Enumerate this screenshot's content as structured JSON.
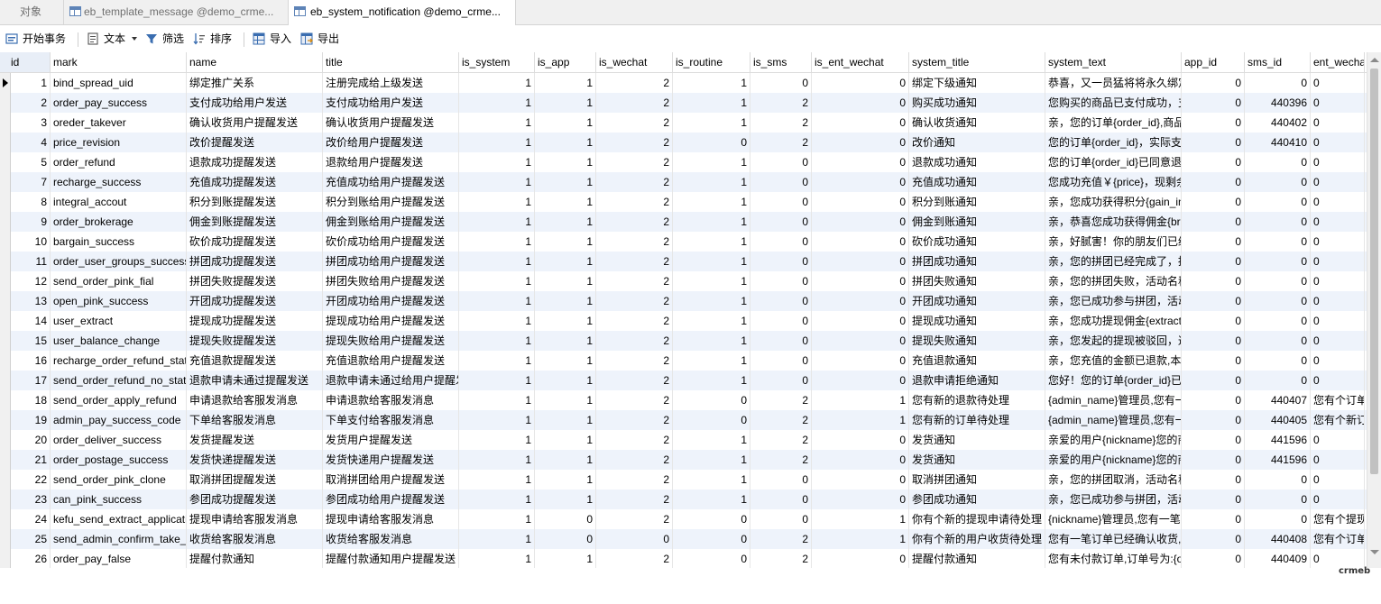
{
  "tabs": [
    {
      "label": "对象",
      "active": false
    },
    {
      "label": "eb_template_message @demo_crme...",
      "active": false
    },
    {
      "label": "eb_system_notification @demo_crme...",
      "active": true
    }
  ],
  "toolbar": {
    "begin_transaction": "开始事务",
    "text": "文本",
    "filter": "筛选",
    "sort": "排序",
    "import": "导入",
    "export": "导出"
  },
  "table": {
    "columns": [
      {
        "label": "id",
        "align": "n"
      },
      {
        "label": "mark",
        "align": "t"
      },
      {
        "label": "name",
        "align": "t"
      },
      {
        "label": "title",
        "align": "t"
      },
      {
        "label": "is_system",
        "align": "n"
      },
      {
        "label": "is_app",
        "align": "n"
      },
      {
        "label": "is_wechat",
        "align": "n"
      },
      {
        "label": "is_routine",
        "align": "n"
      },
      {
        "label": "is_sms",
        "align": "n"
      },
      {
        "label": "is_ent_wechat",
        "align": "n"
      },
      {
        "label": "system_title",
        "align": "t"
      },
      {
        "label": "system_text",
        "align": "t"
      },
      {
        "label": "app_id",
        "align": "n"
      },
      {
        "label": "sms_id",
        "align": "n"
      },
      {
        "label": "ent_wechat",
        "align": "t"
      }
    ],
    "rows": [
      [
        "1",
        "bind_spread_uid",
        "绑定推广关系",
        "注册完成给上级发送",
        "1",
        "1",
        "2",
        "1",
        "0",
        "0",
        "绑定下级通知",
        "恭喜，又一员猛将将永久绑定到您的团队",
        "0",
        "0",
        "0"
      ],
      [
        "2",
        "order_pay_success",
        "支付成功给用户发送",
        "支付成功给用户发送",
        "1",
        "1",
        "2",
        "1",
        "2",
        "0",
        "购买成功通知",
        "您购买的商品已支付成功，支付金额",
        "0",
        "440396",
        "0"
      ],
      [
        "3",
        "oreder_takever",
        "确认收货用户提醒发送",
        "确认收货用户提醒发送",
        "1",
        "1",
        "2",
        "1",
        "2",
        "0",
        "确认收货通知",
        "亲，您的订单{order_id},商品已确认收货",
        "0",
        "440402",
        "0"
      ],
      [
        "4",
        "price_revision",
        "改价提醒发送",
        "改价给用户提醒发送",
        "1",
        "1",
        "2",
        "0",
        "2",
        "0",
        "改价通知",
        "您的订单{order_id}，实际支付金额已被修改",
        "0",
        "440410",
        "0"
      ],
      [
        "5",
        "order_refund",
        "退款成功提醒发送",
        "退款给用户提醒发送",
        "1",
        "1",
        "2",
        "1",
        "0",
        "0",
        "退款成功通知",
        "您的订单{order_id}已同意退款",
        "0",
        "0",
        "0"
      ],
      [
        "7",
        "recharge_success",
        "充值成功提醒发送",
        "充值成功给用户提醒发送",
        "1",
        "1",
        "2",
        "1",
        "0",
        "0",
        "充值成功通知",
        "您成功充值￥{price}，现剩余余额",
        "0",
        "0",
        "0"
      ],
      [
        "8",
        "integral_accout",
        "积分到账提醒发送",
        "积分到账给用户提醒发送",
        "1",
        "1",
        "2",
        "1",
        "0",
        "0",
        "积分到账通知",
        "亲，您成功获得积分{gain_integral}",
        "0",
        "0",
        "0"
      ],
      [
        "9",
        "order_brokerage",
        "佣金到账提醒发送",
        "佣金到账给用户提醒发送",
        "1",
        "1",
        "2",
        "1",
        "0",
        "0",
        "佣金到账通知",
        "亲，恭喜您成功获得佣金{brokerage_price}",
        "0",
        "0",
        "0"
      ],
      [
        "10",
        "bargain_success",
        "砍价成功提醒发送",
        "砍价成功给用户提醒发送",
        "1",
        "1",
        "2",
        "1",
        "0",
        "0",
        "砍价成功通知",
        "亲，好腻害！你的朋友们已经帮你砍到底价",
        "0",
        "0",
        "0"
      ],
      [
        "11",
        "order_user_groups_success",
        "拼团成功提醒发送",
        "拼团成功给用户提醒发送",
        "1",
        "1",
        "2",
        "1",
        "0",
        "0",
        "拼团成功通知",
        "亲，您的拼团已经完成了，拼团名称",
        "0",
        "0",
        "0"
      ],
      [
        "12",
        "send_order_pink_fial",
        "拼团失败提醒发送",
        "拼团失败给用户提醒发送",
        "1",
        "1",
        "2",
        "1",
        "0",
        "0",
        "拼团失败通知",
        "亲，您的拼团失败，活动名称",
        "0",
        "0",
        "0"
      ],
      [
        "13",
        "open_pink_success",
        "开团成功提醒发送",
        "开团成功给用户提醒发送",
        "1",
        "1",
        "2",
        "1",
        "0",
        "0",
        "开团成功通知",
        "亲，您已成功参与拼团，活动名称",
        "0",
        "0",
        "0"
      ],
      [
        "14",
        "user_extract",
        "提现成功提醒发送",
        "提现成功给用户提醒发送",
        "1",
        "1",
        "2",
        "1",
        "0",
        "0",
        "提现成功通知",
        "亲，您成功提现佣金{extract_number}",
        "0",
        "0",
        "0"
      ],
      [
        "15",
        "user_balance_change",
        "提现失败提醒发送",
        "提现失败给用户提醒发送",
        "1",
        "1",
        "2",
        "1",
        "0",
        "0",
        "提现失败通知",
        "亲，您发起的提现被驳回，返还佣金",
        "0",
        "0",
        "0"
      ],
      [
        "16",
        "recharge_order_refund_status",
        "充值退款提醒发送",
        "充值退款给用户提醒发送",
        "1",
        "1",
        "2",
        "1",
        "0",
        "0",
        "充值退款通知",
        "亲，您充值的金额已退款,本次退款",
        "0",
        "0",
        "0"
      ],
      [
        "17",
        "send_order_refund_no_status",
        "退款申请未通过提醒发送",
        "退款申请未通过给用户提醒发送",
        "1",
        "1",
        "2",
        "1",
        "0",
        "0",
        "退款申请拒绝通知",
        "您好！您的订单{order_id}已拒绝退款",
        "0",
        "0",
        "0"
      ],
      [
        "18",
        "send_order_apply_refund",
        "申请退款给客服发消息",
        "申请退款给客服发消息",
        "1",
        "1",
        "2",
        "0",
        "2",
        "1",
        "您有新的退款待处理",
        "{admin_name}管理员,您有一笔退款订单待处理",
        "0",
        "440407",
        "您有个订单"
      ],
      [
        "19",
        "admin_pay_success_code",
        "下单给客服发消息",
        "下单支付给客服发消息",
        "1",
        "1",
        "2",
        "0",
        "2",
        "1",
        "您有新的订单待处理",
        "{admin_name}管理员,您有一笔支付成功的订单",
        "0",
        "440405",
        "您有个新订"
      ],
      [
        "20",
        "order_deliver_success",
        "发货提醒发送",
        "发货用户提醒发送",
        "1",
        "1",
        "2",
        "1",
        "2",
        "0",
        "发货通知",
        "亲爱的用户{nickname}您的商品已发货",
        "0",
        "441596",
        "0"
      ],
      [
        "21",
        "order_postage_success",
        "发货快递提醒发送",
        "发货快递用户提醒发送",
        "1",
        "1",
        "2",
        "1",
        "2",
        "0",
        "发货通知",
        "亲爱的用户{nickname}您的商品已发货",
        "0",
        "441596",
        "0"
      ],
      [
        "22",
        "send_order_pink_clone",
        "取消拼团提醒发送",
        "取消拼团给用户提醒发送",
        "1",
        "1",
        "2",
        "1",
        "0",
        "0",
        "取消拼团通知",
        "亲，您的拼团取消，活动名称",
        "0",
        "0",
        "0"
      ],
      [
        "23",
        "can_pink_success",
        "参团成功提醒发送",
        "参团成功给用户提醒发送",
        "1",
        "1",
        "2",
        "1",
        "0",
        "0",
        "参团成功通知",
        "亲，您已成功参与拼团，活动名称",
        "0",
        "0",
        "0"
      ],
      [
        "24",
        "kefu_send_extract_application",
        "提现申请给客服发消息",
        "提现申请给客服发消息",
        "1",
        "0",
        "2",
        "0",
        "0",
        "1",
        "你有个新的提现申请待处理",
        "{nickname}管理员,您有一笔提现申请待处理",
        "0",
        "0",
        "您有个提现"
      ],
      [
        "25",
        "send_admin_confirm_take_over",
        "收货给客服发消息",
        "收货给客服发消息",
        "1",
        "0",
        "0",
        "0",
        "2",
        "1",
        "你有个新的用户收货待处理",
        "您有一笔订单已经确认收货,订单号",
        "0",
        "440408",
        "您有个订单"
      ],
      [
        "26",
        "order_pay_false",
        "提醒付款通知",
        "提醒付款通知用户提醒发送",
        "1",
        "1",
        "2",
        "0",
        "2",
        "0",
        "提醒付款通知",
        "您有未付款订单,订单号为:{order_id}",
        "0",
        "440409",
        "0"
      ]
    ]
  },
  "watermark": "crmeb"
}
